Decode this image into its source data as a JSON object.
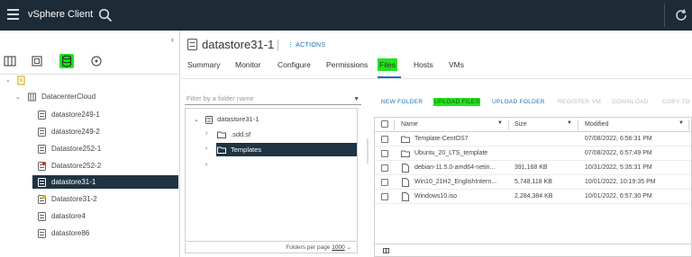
{
  "app": {
    "title": "vSphere Client"
  },
  "object": {
    "title": "datastore31-1",
    "actions_label": "ACTIONS"
  },
  "tabs": [
    {
      "label": "Summary"
    },
    {
      "label": "Monitor"
    },
    {
      "label": "Configure"
    },
    {
      "label": "Permissions"
    },
    {
      "label": "Files",
      "active": true
    },
    {
      "label": "Hosts"
    },
    {
      "label": "VMs"
    }
  ],
  "nav_icons": [
    "hosts-clusters-icon",
    "vms-templates-icon",
    "storage-icon",
    "networking-icon"
  ],
  "tree": {
    "datacenter": "DatacenterCloud",
    "items": [
      {
        "label": "datastore249-1",
        "status": "normal"
      },
      {
        "label": "datastore249-2",
        "status": "normal"
      },
      {
        "label": "Datastore252-1",
        "status": "normal"
      },
      {
        "label": "Datastore252-2",
        "status": "alert"
      },
      {
        "label": "datastore31-1",
        "status": "normal",
        "selected": true
      },
      {
        "label": "Datastore31-2",
        "status": "warning"
      },
      {
        "label": "datastore4",
        "status": "normal"
      },
      {
        "label": "datastore86",
        "status": "normal"
      }
    ]
  },
  "folder_panel": {
    "filter_placeholder": "Filter by a folder name",
    "root": "datastore31-1",
    "folders": [
      {
        "label": ".sdd.sf",
        "selected": false
      },
      {
        "label": "Templates",
        "selected": true
      },
      {
        "label": "",
        "selected": false
      }
    ],
    "per_page_label": "Folders per page",
    "per_page_value": "1000"
  },
  "file_toolbar": {
    "new_folder": "NEW FOLDER",
    "upload_files": "UPLOAD FILES",
    "upload_folder": "UPLOAD FOLDER",
    "register_vm": "REGISTER VM",
    "download": "DOWNLOAD",
    "copy_to": "COPY TO"
  },
  "file_grid": {
    "columns": {
      "name": "Name",
      "size": "Size",
      "modified": "Modified"
    },
    "rows": [
      {
        "name": "Template-CentOS7",
        "size": "",
        "modified": "07/08/2022, 6:56:31 PM",
        "kind": "folder"
      },
      {
        "name": "Ubuntu_20_LTS_template",
        "size": "",
        "modified": "07/08/2022, 6:57:49 PM",
        "kind": "folder"
      },
      {
        "name": "debian-11.5.0-amd64-netin...",
        "size": "391,168 KB",
        "modified": "10/31/2022, 5:35:31 PM",
        "kind": "file"
      },
      {
        "name": "Win10_21H2_EnglishIntern...",
        "size": "5,748,118 KB",
        "modified": "10/01/2022, 10:19:35 PM",
        "kind": "file"
      },
      {
        "name": "Windows10.iso",
        "size": "2,284,384 KB",
        "modified": "10/01/2022, 6:57:30 PM",
        "kind": "file"
      }
    ]
  },
  "colors": {
    "header_bg": "#1d2b36",
    "selection_bg": "#1f3443",
    "link_blue": "#1d6fb8",
    "highlight_green": "#22e21e"
  }
}
